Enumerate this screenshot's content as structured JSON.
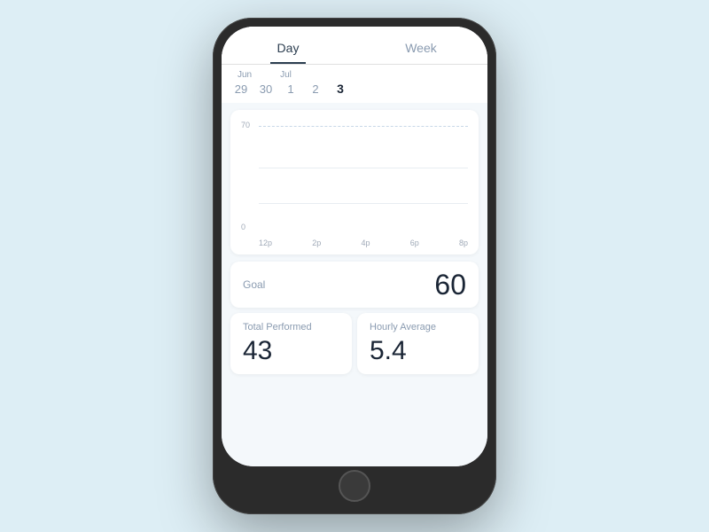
{
  "tabs": [
    {
      "label": "Day",
      "active": true
    },
    {
      "label": "Week",
      "active": false
    }
  ],
  "months": [
    {
      "label": "Jun",
      "offset": 1
    },
    {
      "label": "Jul",
      "offset": 3
    }
  ],
  "dates": [
    {
      "value": "29",
      "active": false
    },
    {
      "value": "30",
      "active": false
    },
    {
      "value": "1",
      "active": false
    },
    {
      "value": "2",
      "active": false
    },
    {
      "value": "3",
      "active": true
    }
  ],
  "chart": {
    "y_max": "70",
    "y_min": "0",
    "x_labels": [
      "12p",
      "2p",
      "4p",
      "6p",
      "8p"
    ]
  },
  "goal": {
    "label": "Goal",
    "value": "60"
  },
  "total_performed": {
    "label": "Total Performed",
    "value": "43"
  },
  "hourly_average": {
    "label": "Hourly Average",
    "value": "5.4"
  }
}
